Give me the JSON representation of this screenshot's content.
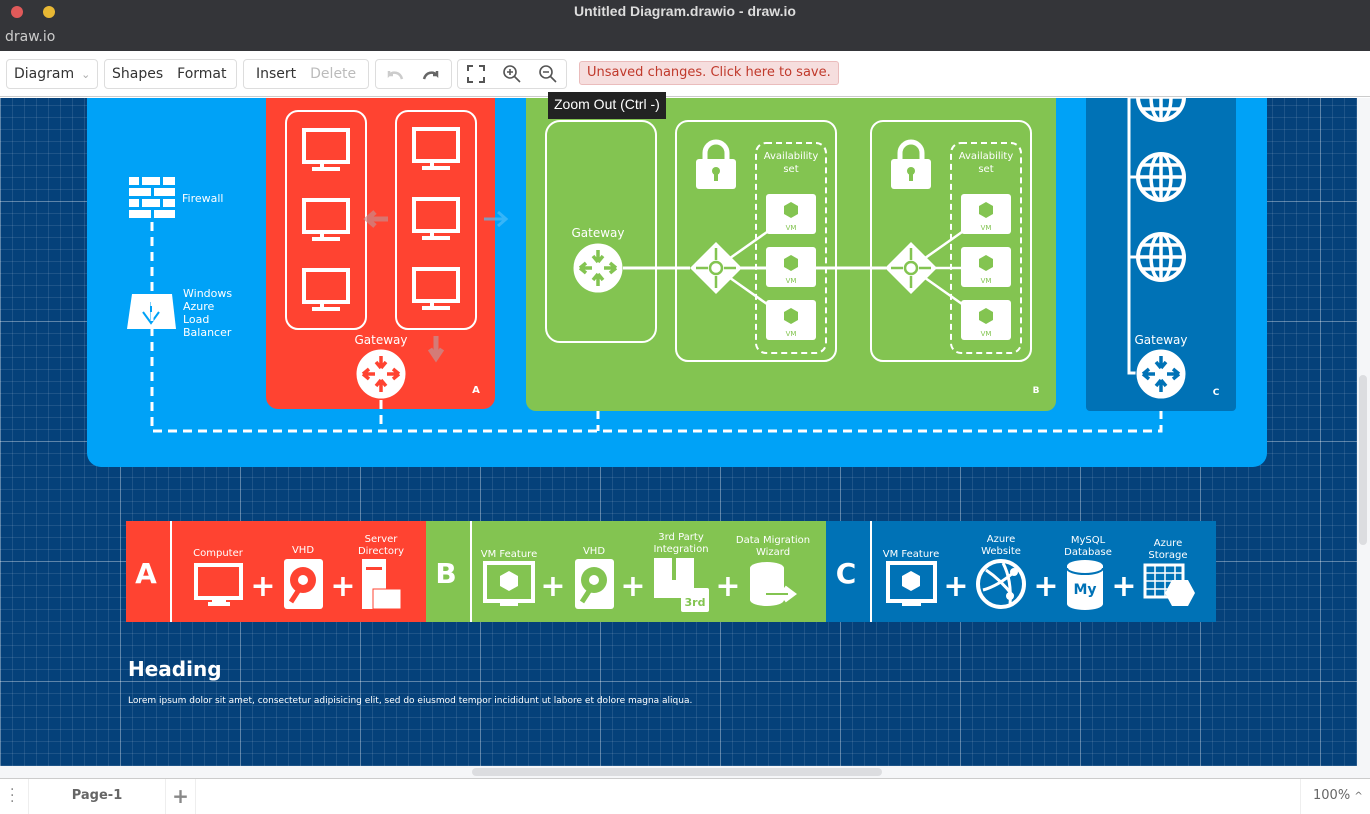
{
  "window": {
    "title": "Untitled Diagram.drawio - draw.io",
    "app_menu": "draw.io"
  },
  "toolbar": {
    "diagram": "Diagram",
    "shapes": "Shapes",
    "format": "Format",
    "insert": "Insert",
    "delete": "Delete",
    "unsaved": "Unsaved changes. Click here to save.",
    "tooltip": "Zoom Out (Ctrl -)"
  },
  "diagram": {
    "firewall": "Firewall",
    "lb": [
      "Windows",
      "Azure",
      "Load",
      "Balancer"
    ],
    "gateway": "Gateway",
    "availability": [
      "Availability",
      "set"
    ],
    "vm": "VM",
    "panel_a": "A",
    "panel_b": "B",
    "panel_c": "C"
  },
  "legend": {
    "a": {
      "letter": "A",
      "items": [
        {
          "label": [
            "Computer"
          ]
        },
        {
          "label": [
            "VHD"
          ]
        },
        {
          "label": [
            "Server",
            "Directory"
          ]
        }
      ]
    },
    "b": {
      "letter": "B",
      "items": [
        {
          "label": [
            "VM Feature"
          ]
        },
        {
          "label": [
            "VHD"
          ]
        },
        {
          "label": [
            "3rd Party",
            "Integration"
          ]
        },
        {
          "label": [
            "Data Migration",
            "Wizard"
          ]
        }
      ],
      "third_badge": "3rd"
    },
    "c": {
      "letter": "C",
      "items": [
        {
          "label": [
            "VM Feature"
          ]
        },
        {
          "label": [
            "Azure",
            "Website"
          ]
        },
        {
          "label": [
            "MySQL",
            "Database"
          ]
        },
        {
          "label": [
            "Azure",
            "Storage"
          ]
        }
      ],
      "my": "My"
    },
    "plus": "+"
  },
  "text_block": {
    "heading": "Heading",
    "body": "Lorem ipsum dolor sit amet, consectetur adipisicing elit, sed do eiusmod tempor incididunt ut labore et dolore magna aliqua."
  },
  "footer": {
    "page": "Page-1",
    "add": "+",
    "zoom": "100%"
  },
  "colors": {
    "outer": "#00a2f7",
    "red": "#ff4331",
    "green": "#83c451",
    "blue": "#0072b6",
    "canvas": "#05417a"
  }
}
